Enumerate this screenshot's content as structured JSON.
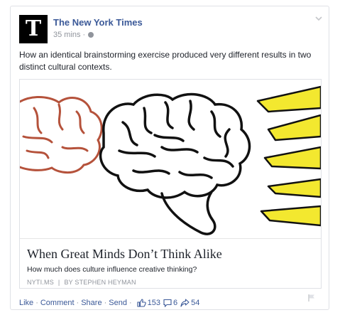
{
  "post": {
    "page_name": "The New York Times",
    "avatar_letter": "T",
    "time": "35 mins",
    "meta_sep": "·",
    "privacy_icon": "globe-icon",
    "text": "How an identical brainstorming exercise produced very different results in two distinct cultural contexts."
  },
  "link": {
    "title": "When Great Minds Don’t Think Alike",
    "description": "How much does culture influence creative thinking?",
    "source": "NYTI.MS",
    "source_sep": "|",
    "byline": "BY STEPHEN HEYMAN"
  },
  "actions": {
    "like": "Like",
    "comment": "Comment",
    "share": "Share",
    "send": "Send",
    "sep": "·",
    "likes_count": "153",
    "comments_count": "6",
    "shares_count": "54"
  },
  "colors": {
    "link_blue": "#3b5998",
    "meta_gray": "#90949c",
    "brain_red": "#b5523b",
    "brain_black": "#111111",
    "burst_yellow": "#f3e82f"
  }
}
